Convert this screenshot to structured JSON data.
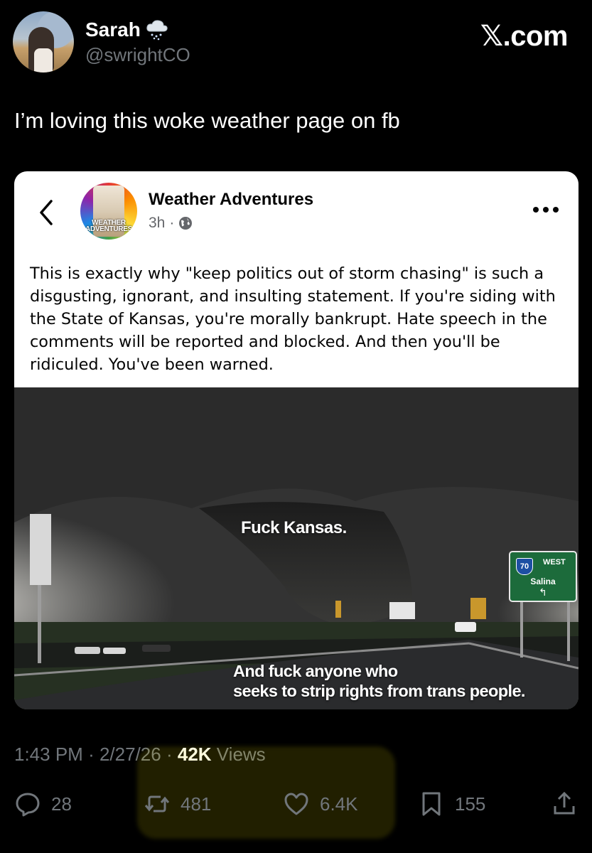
{
  "user": {
    "display_name": "Sarah",
    "handle": "@swrightCO",
    "name_emoji_icon": "cloud-with-snow-icon"
  },
  "brand": {
    "label": "𝕏.com"
  },
  "tweet": {
    "text": "I’m loving this woke weather page on fb",
    "time": "1:43 PM",
    "sep1": "·",
    "date": "2/27/26",
    "sep2": "·",
    "views_count": "42K",
    "views_label": "Views"
  },
  "fb_post": {
    "page_name": "Weather Adventures",
    "avatar_label": "WEATHER ADVENTURES",
    "time": "3h",
    "dot": "·",
    "body": "This is exactly why \"keep politics out of storm chasing\" is such a disgusting, ignorant, and insulting statement. If you're siding with the State of Kansas, you're morally bankrupt. Hate speech in the comments will be reported and blocked. And then you'll be ridiculed. You've been warned.",
    "image": {
      "overlay_top": "Fuck Kansas.",
      "overlay_bottom_line1": "And fuck anyone who",
      "overlay_bottom_line2": "seeks to strip rights from trans people.",
      "sign": {
        "route": "70",
        "direction": "WEST",
        "city": "Salina",
        "arrow": "↰"
      }
    }
  },
  "actions": {
    "replies": "28",
    "reposts": "481",
    "likes": "6.4K",
    "bookmarks": "155"
  },
  "colors": {
    "background": "#000000",
    "muted": "#71767b",
    "highlight": "#ffee00",
    "fb_text": "#050505"
  }
}
